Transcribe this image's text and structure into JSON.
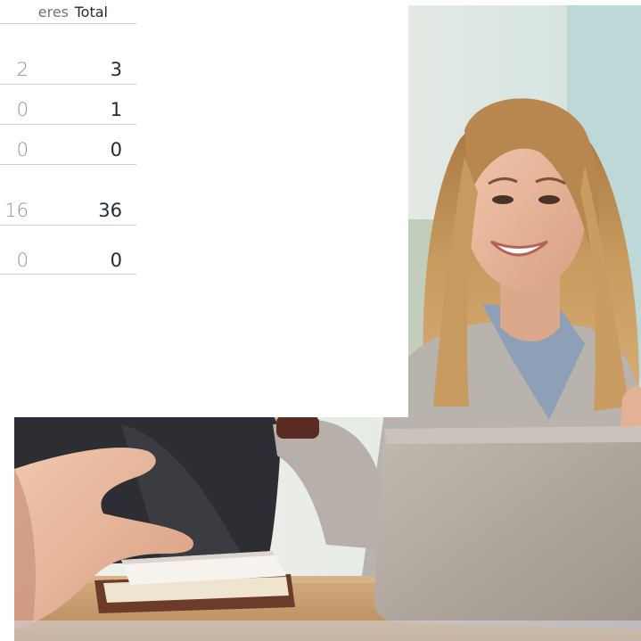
{
  "table": {
    "headers": {
      "partial": "eres",
      "total": "Total"
    },
    "rows": [
      {
        "sub": "2",
        "total": "3"
      },
      {
        "sub": "0",
        "total": "1"
      },
      {
        "sub": "0",
        "total": "0"
      },
      {
        "sub": "16",
        "total": "36"
      },
      {
        "sub": "0",
        "total": "0"
      }
    ]
  },
  "photo": {
    "subject": "smiling woman at laptop in meeting",
    "colors": {
      "window": "#dfe9e6",
      "hair": "#b8864f",
      "skin": "#e8b79a",
      "sweater": "#b8b2ac",
      "shirt": "#8fa1b8",
      "laptop": "#b5aca3",
      "table": "#c49a6c",
      "book": "#6d3b2a",
      "dark_jacket": "#2c2e33"
    }
  }
}
